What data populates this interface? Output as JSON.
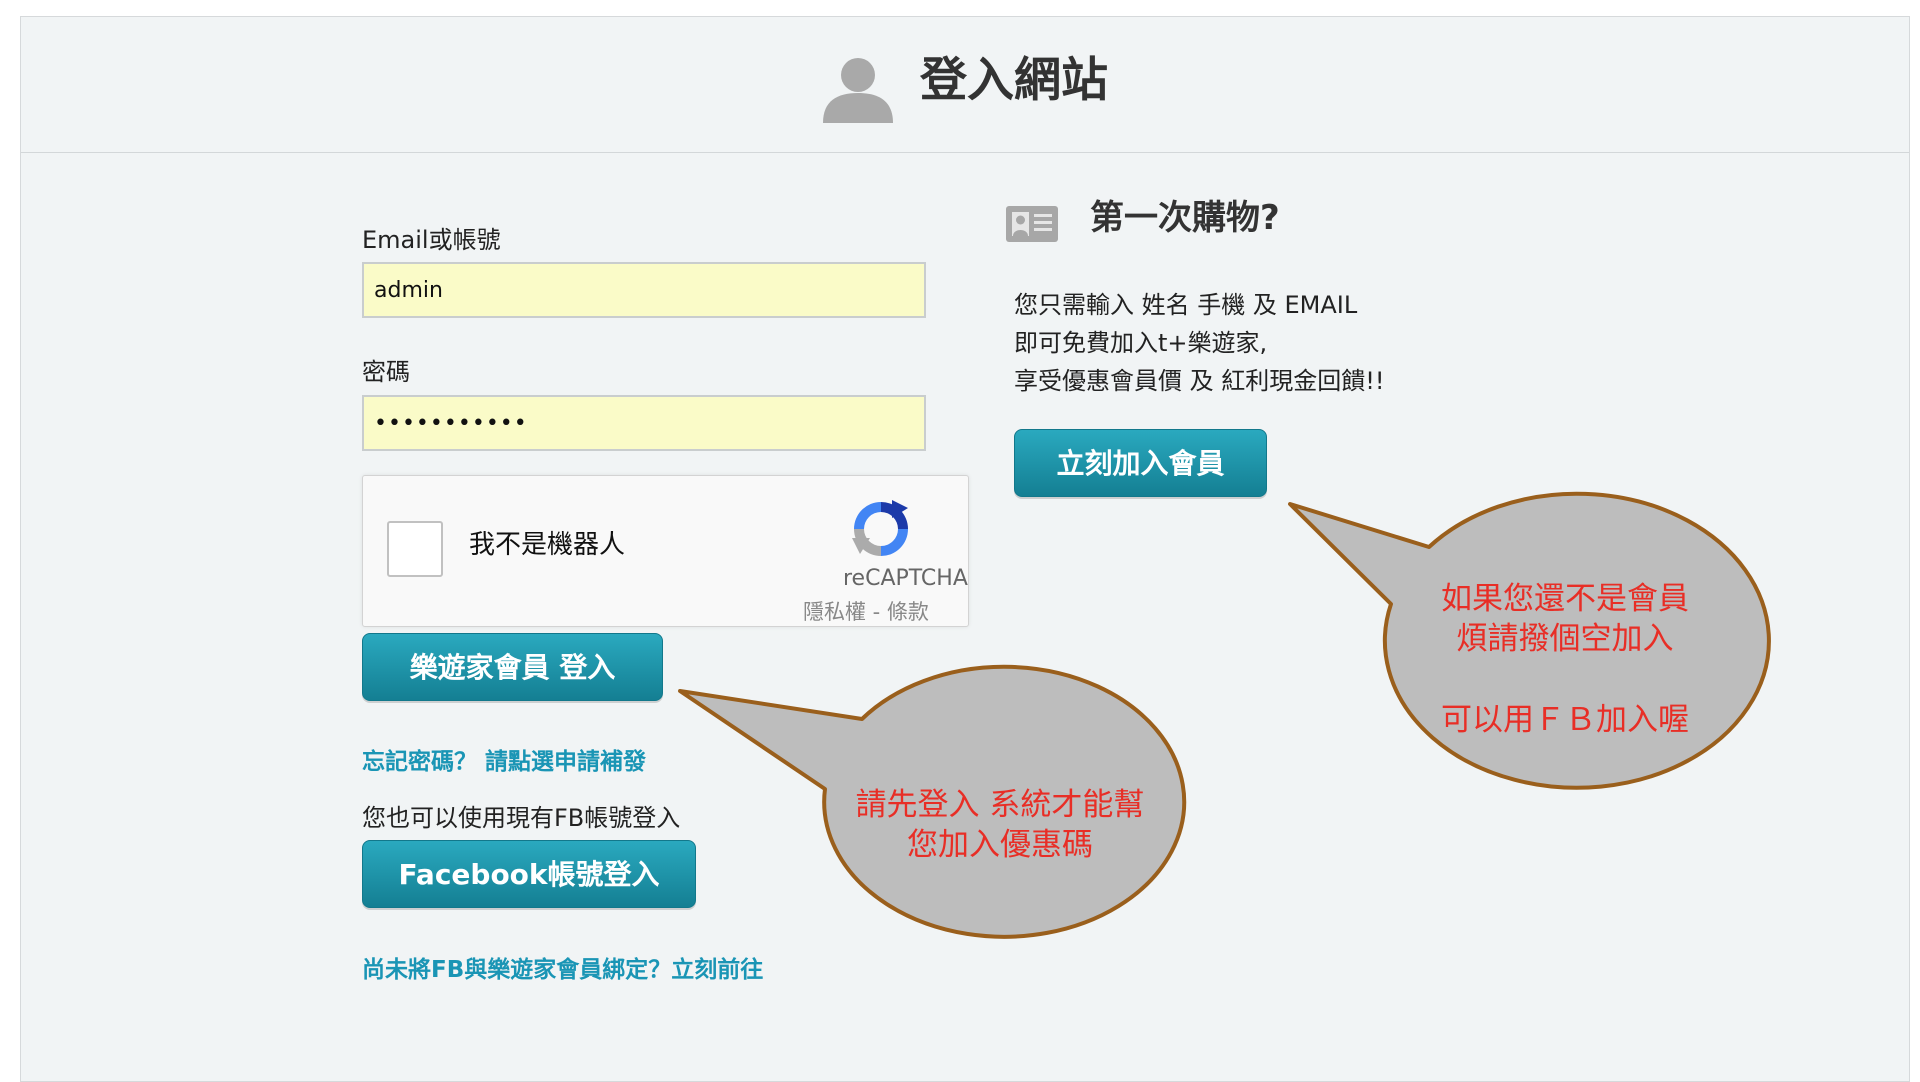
{
  "header": {
    "title": "登入網站",
    "icon": "user-silhouette-icon"
  },
  "login_form": {
    "email_label": "Email或帳號",
    "email_value": "admin",
    "password_label": "密碼",
    "password_value": "•••••••••••",
    "recaptcha": {
      "label": "我不是機器人",
      "brand": "reCAPTCHA",
      "terms": "隱私權 - 條款",
      "checked": false
    },
    "login_button": "樂遊家會員 登入",
    "forgot_link": "忘記密碼？ 請點選申請補發",
    "fb_hint": "您也可以使用現有FB帳號登入",
    "fb_button": "Facebook帳號登入",
    "fb_bind_link": "尚未將FB與樂遊家會員綁定？立刻前往"
  },
  "first_time": {
    "icon": "id-card-icon",
    "title": "第一次購物?",
    "lines": [
      "您只需輸入 姓名 手機 及 EMAIL",
      "即可免費加入t+樂遊家,",
      "享受優惠會員價 及 紅利現金回饋!!"
    ],
    "join_button": "立刻加入會員"
  },
  "callouts": {
    "left": [
      "請先登入 系統才能幫",
      "您加入優惠碼"
    ],
    "right": [
      "如果您還不是會員",
      "煩請撥個空加入",
      "",
      "可以用ＦＢ加入喔"
    ]
  },
  "colors": {
    "button": "#1a95ab",
    "link": "#1a95b5",
    "input_fill": "#fafbc8",
    "callout_fill": "#bdbdbd",
    "callout_border": "#9a5f1c",
    "callout_text": "#e82e26"
  }
}
